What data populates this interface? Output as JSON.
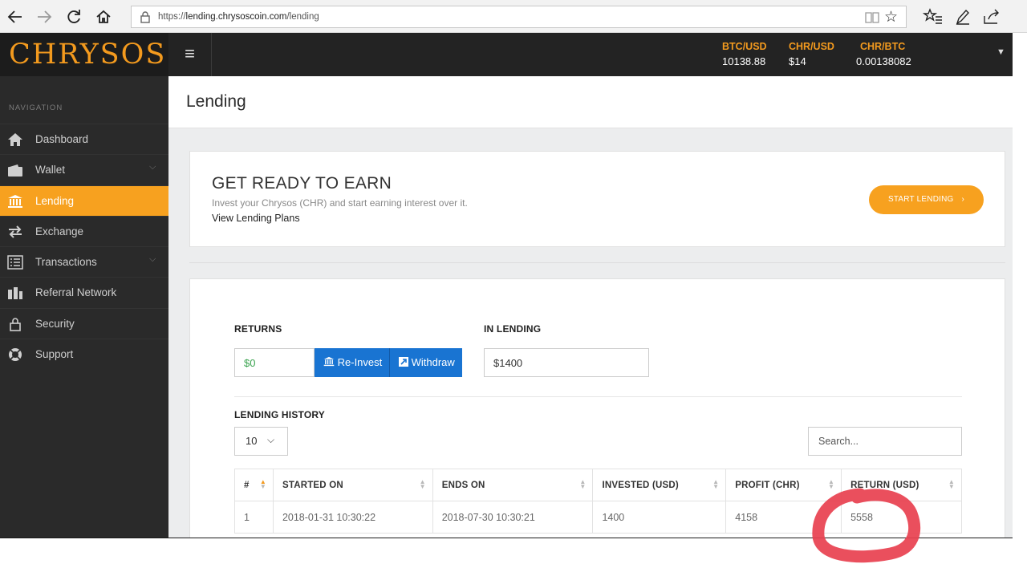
{
  "browser": {
    "url_prefix": "https://",
    "url_host": "lending.chrysoscoin.com",
    "url_path": "/lending"
  },
  "header": {
    "logo_text": "CHRYSOS",
    "tickers": [
      {
        "label": "BTC/USD",
        "value": "10138.88"
      },
      {
        "label": "CHR/USD",
        "value": "$14"
      },
      {
        "label": "CHR/BTC",
        "value": "0.00138082"
      }
    ]
  },
  "sidebar": {
    "heading": "NAVIGATION",
    "items": [
      {
        "label": "Dashboard",
        "icon": "home-icon",
        "has_submenu": false,
        "active": false
      },
      {
        "label": "Wallet",
        "icon": "wallet-icon",
        "has_submenu": true,
        "active": false
      },
      {
        "label": "Lending",
        "icon": "bank-icon",
        "has_submenu": false,
        "active": true
      },
      {
        "label": "Exchange",
        "icon": "exchange-icon",
        "has_submenu": false,
        "active": false
      },
      {
        "label": "Transactions",
        "icon": "list-icon",
        "has_submenu": true,
        "active": false
      },
      {
        "label": "Referral Network",
        "icon": "users-icon",
        "has_submenu": false,
        "active": false
      },
      {
        "label": "Security",
        "icon": "lock-icon",
        "has_submenu": false,
        "active": false
      },
      {
        "label": "Support",
        "icon": "lifebuoy-icon",
        "has_submenu": false,
        "active": false
      }
    ]
  },
  "page": {
    "title": "Lending"
  },
  "earn_card": {
    "title": "GET READY TO EARN",
    "subtitle": "Invest your Chrysos (CHR) and start earning interest over it.",
    "link": "View Lending Plans",
    "button_label": "START LENDING",
    "button_arrow": "›"
  },
  "returns": {
    "label": "RETURNS",
    "value": "$0",
    "reinvest_label": "Re-Invest",
    "withdraw_label": "Withdraw"
  },
  "in_lending": {
    "label": "IN LENDING",
    "value": "$1400"
  },
  "history": {
    "label": "LENDING HISTORY",
    "page_length": "10",
    "search_placeholder": "Search...",
    "columns": [
      "#",
      "STARTED ON",
      "ENDS ON",
      "INVESTED (USD)",
      "PROFIT (CHR)",
      "RETURN (USD)"
    ],
    "rows": [
      [
        "1",
        "2018-01-31 10:30:22",
        "2018-07-30 10:30:21",
        "1400",
        "4158",
        "5558"
      ]
    ]
  },
  "colors": {
    "accent": "#f7a11f",
    "primary_button": "#1974d2",
    "sidebar_bg": "#2a2a2a",
    "header_bg": "#232323",
    "annotation": "#e8404f"
  }
}
